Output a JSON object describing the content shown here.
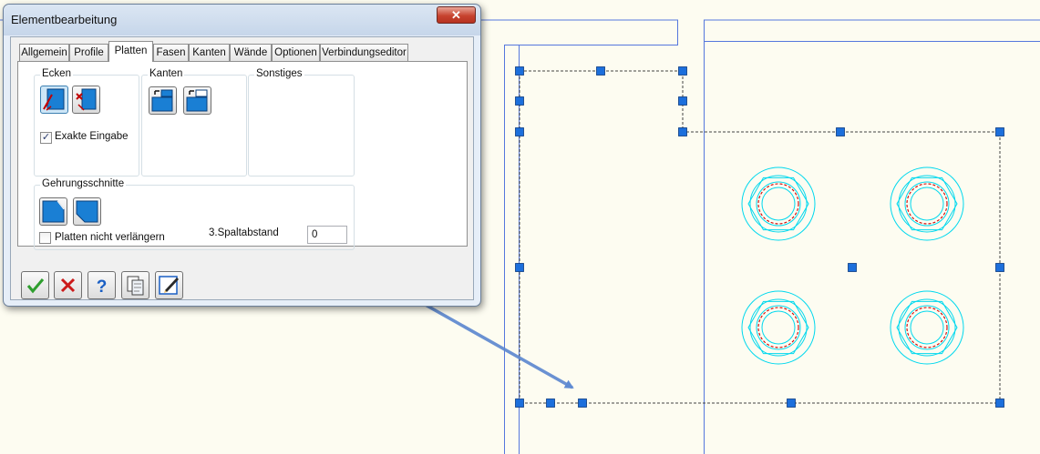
{
  "dialog": {
    "title": "Elementbearbeitung",
    "close_glyph": "✕",
    "tabs": [
      {
        "label": "Allgemein",
        "active": false
      },
      {
        "label": "Profile",
        "active": false
      },
      {
        "label": "Platten",
        "active": true
      },
      {
        "label": "Fasen",
        "active": false
      },
      {
        "label": "Kanten",
        "active": false
      },
      {
        "label": "Wände",
        "active": false
      },
      {
        "label": "Optionen",
        "active": false
      },
      {
        "label": "Verbindungseditor",
        "active": false
      }
    ],
    "groups": {
      "ecken": {
        "label": "Ecken",
        "buttons": [
          {
            "icon": "corner-miter-icon",
            "selected": true
          },
          {
            "icon": "corner-cut-icon",
            "selected": false
          }
        ],
        "checkbox": {
          "label": "Exakte Eingabe",
          "checked": true
        }
      },
      "kanten": {
        "label": "Kanten",
        "buttons": [
          {
            "icon": "edge-extend-icon",
            "selected": false
          },
          {
            "icon": "edge-trim-icon",
            "selected": false
          }
        ]
      },
      "sonstiges": {
        "label": "Sonstiges"
      },
      "gehrung": {
        "label": "Gehrungsschnitte",
        "buttons": [
          {
            "icon": "miter-cut-left-icon",
            "selected": false
          },
          {
            "icon": "miter-cut-right-icon",
            "selected": false
          }
        ],
        "checkbox": {
          "label": "Platten nicht verlängern",
          "checked": false
        },
        "gap_label": "3.Spaltabstand",
        "gap_value": "0"
      }
    },
    "bottom_buttons": [
      {
        "icon": "ok-check-icon"
      },
      {
        "icon": "cancel-x-icon"
      },
      {
        "icon": "help-question-icon"
      },
      {
        "icon": "copy-document-icon"
      },
      {
        "icon": "edit-pencil-icon"
      }
    ]
  },
  "colors": {
    "canvas_background": "#fdfcf1",
    "drawing_lines": "#5577dd",
    "bolt_cyan": "#00d8ee",
    "bolt_red_dashed": "#d40000",
    "grip_blue": "#1c6fdc",
    "annotation_arrow": "#5b86cf"
  }
}
